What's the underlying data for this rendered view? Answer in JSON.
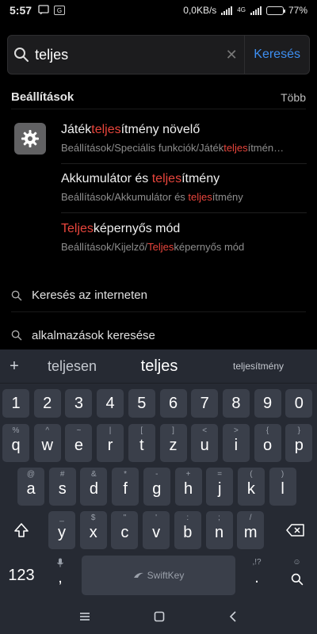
{
  "status": {
    "time": "5:57",
    "net_speed": "0,0KB/s",
    "network_type": "4G",
    "battery": "77%",
    "battery_level": 0.77
  },
  "search": {
    "query": "teljes",
    "button": "Keresés"
  },
  "section": {
    "title": "Beállítások",
    "more": "Több"
  },
  "results": [
    {
      "title_parts": [
        "Játék",
        "teljes",
        "ítmény növelő"
      ],
      "path_parts": [
        "Beállítások/Speciális funkciók/Játék",
        "teljes",
        "ítmén…"
      ]
    },
    {
      "title_parts": [
        "Akkumulátor és ",
        "teljes",
        "ítmény"
      ],
      "path_parts": [
        "Beállítások/Akkumulátor és ",
        "teljes",
        "ítmény"
      ]
    },
    {
      "title_parts": [
        "",
        "Teljes",
        "képernyős mód"
      ],
      "path_parts": [
        "Beállítások/Kijelző/",
        "Teljes",
        "képernyős mód"
      ]
    }
  ],
  "search_rows": [
    {
      "label": "Keresés az interneten"
    },
    {
      "label": "alkalmazások keresése"
    }
  ],
  "keyboard": {
    "suggestions": [
      "+",
      "teljesen",
      "teljes",
      "teljesítmény"
    ],
    "numbers": [
      "1",
      "2",
      "3",
      "4",
      "5",
      "6",
      "7",
      "8",
      "9",
      "0"
    ],
    "row1": [
      [
        "%",
        "q"
      ],
      [
        "^",
        "w"
      ],
      [
        "~",
        "e"
      ],
      [
        "|",
        "r"
      ],
      [
        "[",
        "t"
      ],
      [
        "]",
        "z"
      ],
      [
        "<",
        "u"
      ],
      [
        ">",
        "i"
      ],
      [
        "{",
        "o"
      ],
      [
        "}",
        "p"
      ]
    ],
    "row2": [
      [
        "@",
        "a"
      ],
      [
        "#",
        "s"
      ],
      [
        "&",
        "d"
      ],
      [
        "*",
        "f"
      ],
      [
        "-",
        "g"
      ],
      [
        "+",
        "h"
      ],
      [
        "=",
        "j"
      ],
      [
        "(",
        "k"
      ],
      [
        ")",
        "l"
      ]
    ],
    "row3": [
      [
        "_",
        "y"
      ],
      [
        "$",
        "x"
      ],
      [
        "\"",
        "c"
      ],
      [
        "'",
        "v"
      ],
      [
        ":",
        "b"
      ],
      [
        ";",
        "n"
      ],
      [
        "/",
        "m"
      ]
    ],
    "row4": {
      "numbers_key": "123",
      "comma": ",",
      "space_brand": "SwiftKey",
      "period_sup": ",!?",
      "period": "."
    }
  }
}
